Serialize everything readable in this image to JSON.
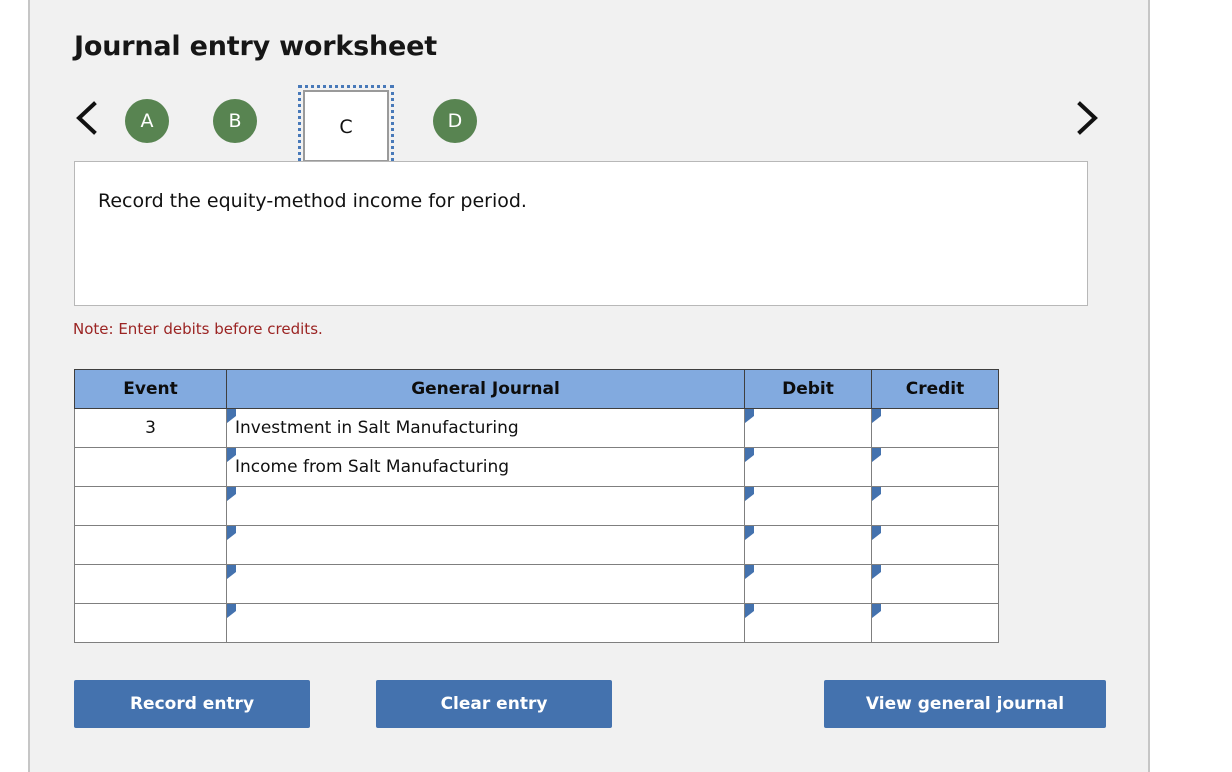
{
  "page": {
    "title": "Journal entry worksheet",
    "note": "Note: Enter debits before credits.",
    "prompt": "Record the equity-method income for period."
  },
  "nav": {
    "prev_icon": "chevron-left-icon",
    "next_icon": "chevron-right-icon",
    "tabs": [
      {
        "label": "A",
        "selected": false
      },
      {
        "label": "B",
        "selected": false
      },
      {
        "label": "C",
        "selected": true
      },
      {
        "label": "D",
        "selected": false
      }
    ]
  },
  "table": {
    "headers": {
      "event": "Event",
      "general_journal": "General Journal",
      "debit": "Debit",
      "credit": "Credit"
    },
    "rows": [
      {
        "event": "3",
        "general_journal": "Investment in Salt Manufacturing",
        "debit": "",
        "credit": ""
      },
      {
        "event": "",
        "general_journal": "Income from Salt Manufacturing",
        "debit": "",
        "credit": ""
      },
      {
        "event": "",
        "general_journal": "",
        "debit": "",
        "credit": ""
      },
      {
        "event": "",
        "general_journal": "",
        "debit": "",
        "credit": ""
      },
      {
        "event": "",
        "general_journal": "",
        "debit": "",
        "credit": ""
      },
      {
        "event": "",
        "general_journal": "",
        "debit": "",
        "credit": ""
      }
    ]
  },
  "buttons": {
    "record": "Record entry",
    "clear": "Clear entry",
    "view_journal": "View general journal"
  },
  "colors": {
    "tab_green": "#588451",
    "header_blue": "#82aadf",
    "button_blue": "#4472ae",
    "note_red": "#9b2423",
    "panel_gray": "#f1f1f1",
    "marker_blue": "#4472ae"
  }
}
